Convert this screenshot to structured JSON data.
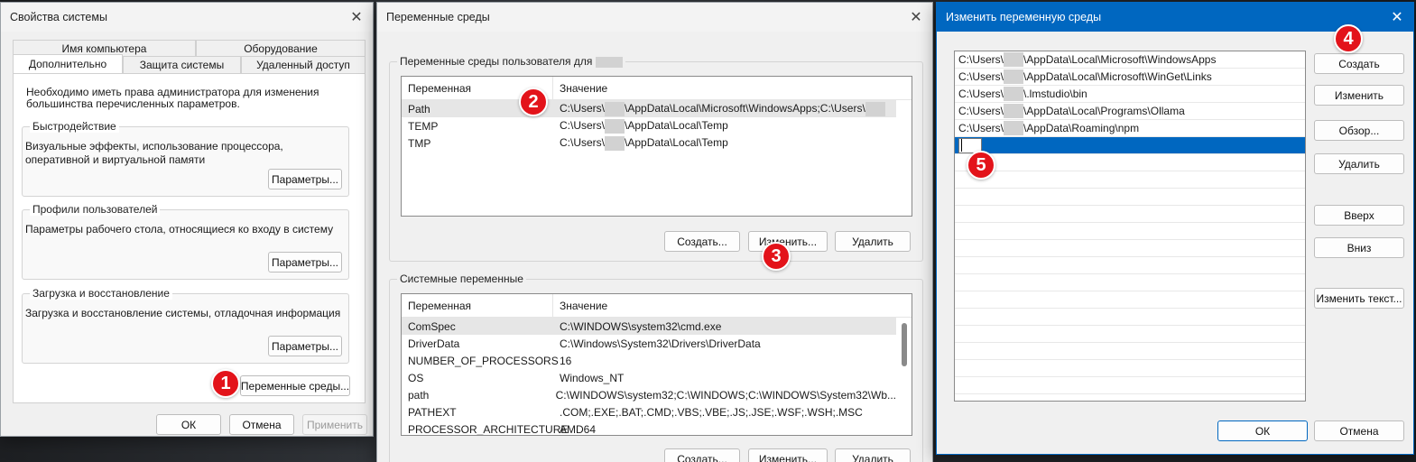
{
  "sysprops": {
    "title": "Свойства системы",
    "tabs_top": [
      "Имя компьютера",
      "Оборудование"
    ],
    "tabs_bottom": [
      "Дополнительно",
      "Защита системы",
      "Удаленный доступ"
    ],
    "admin_note": "Необходимо иметь права администратора для изменения большинства перечисленных параметров.",
    "perf": {
      "title": "Быстродействие",
      "desc": "Визуальные эффекты, использование процессора, оперативной и виртуальной памяти",
      "btn": "Параметры..."
    },
    "profiles": {
      "title": "Профили пользователей",
      "desc": "Параметры рабочего стола, относящиеся ко входу в систему",
      "btn": "Параметры..."
    },
    "startup": {
      "title": "Загрузка и восстановление",
      "desc": "Загрузка и восстановление системы, отладочная информация",
      "btn": "Параметры..."
    },
    "env_btn": "Переменные среды...",
    "ok": "ОК",
    "cancel": "Отмена",
    "apply": "Применить"
  },
  "envvars": {
    "title": "Переменные среды",
    "user_group": "Переменные среды пользователя для",
    "col_var": "Переменная",
    "col_val": "Значение",
    "user_rows": [
      {
        "name": "Path",
        "pre": "C:\\Users\\",
        "val": "\\AppData\\Local\\Microsoft\\WindowsApps;C:\\Users\\"
      },
      {
        "name": "TEMP",
        "pre": "C:\\Users\\",
        "val": "\\AppData\\Local\\Temp"
      },
      {
        "name": "TMP",
        "pre": "C:\\Users\\",
        "val": "\\AppData\\Local\\Temp"
      }
    ],
    "user_new": "Создать...",
    "user_edit": "Изменить...",
    "user_delete": "Удалить",
    "sys_group": "Системные переменные",
    "sys_rows": [
      {
        "name": "ComSpec",
        "val": "C:\\WINDOWS\\system32\\cmd.exe"
      },
      {
        "name": "DriverData",
        "val": "C:\\Windows\\System32\\Drivers\\DriverData"
      },
      {
        "name": "NUMBER_OF_PROCESSORS",
        "val": "16"
      },
      {
        "name": "OS",
        "val": "Windows_NT"
      },
      {
        "name": "path",
        "val": "C:\\WINDOWS\\system32;C:\\WINDOWS;C:\\WINDOWS\\System32\\Wb..."
      },
      {
        "name": "PATHEXT",
        "val": ".COM;.EXE;.BAT;.CMD;.VBS;.VBE;.JS;.JSE;.WSF;.WSH;.MSC"
      },
      {
        "name": "PROCESSOR_ARCHITECTURE",
        "val": "AMD64"
      }
    ],
    "sys_new": "Создать...",
    "sys_edit": "Изменить...",
    "sys_delete": "Удалить"
  },
  "editvar": {
    "title": "Изменить переменную среды",
    "entries": [
      {
        "pre": "C:\\Users\\",
        "post": "\\AppData\\Local\\Microsoft\\WindowsApps"
      },
      {
        "pre": "C:\\Users\\",
        "post": "\\AppData\\Local\\Microsoft\\WinGet\\Links"
      },
      {
        "pre": "C:\\Users\\",
        "post": "\\.lmstudio\\bin"
      },
      {
        "pre": "C:\\Users\\",
        "post": "\\AppData\\Local\\Programs\\Ollama"
      },
      {
        "pre": "C:\\Users\\",
        "post": "\\AppData\\Roaming\\npm"
      }
    ],
    "btn_new": "Создать",
    "btn_edit": "Изменить",
    "btn_browse": "Обзор...",
    "btn_delete": "Удалить",
    "btn_up": "Вверх",
    "btn_down": "Вниз",
    "btn_edit_text": "Изменить текст...",
    "ok": "ОК",
    "cancel": "Отмена"
  },
  "badges": [
    "1",
    "2",
    "3",
    "4",
    "5"
  ],
  "colors": {
    "accent": "#0067c0",
    "badge": "#e3131a",
    "titlebar_active": "#0067c0"
  }
}
